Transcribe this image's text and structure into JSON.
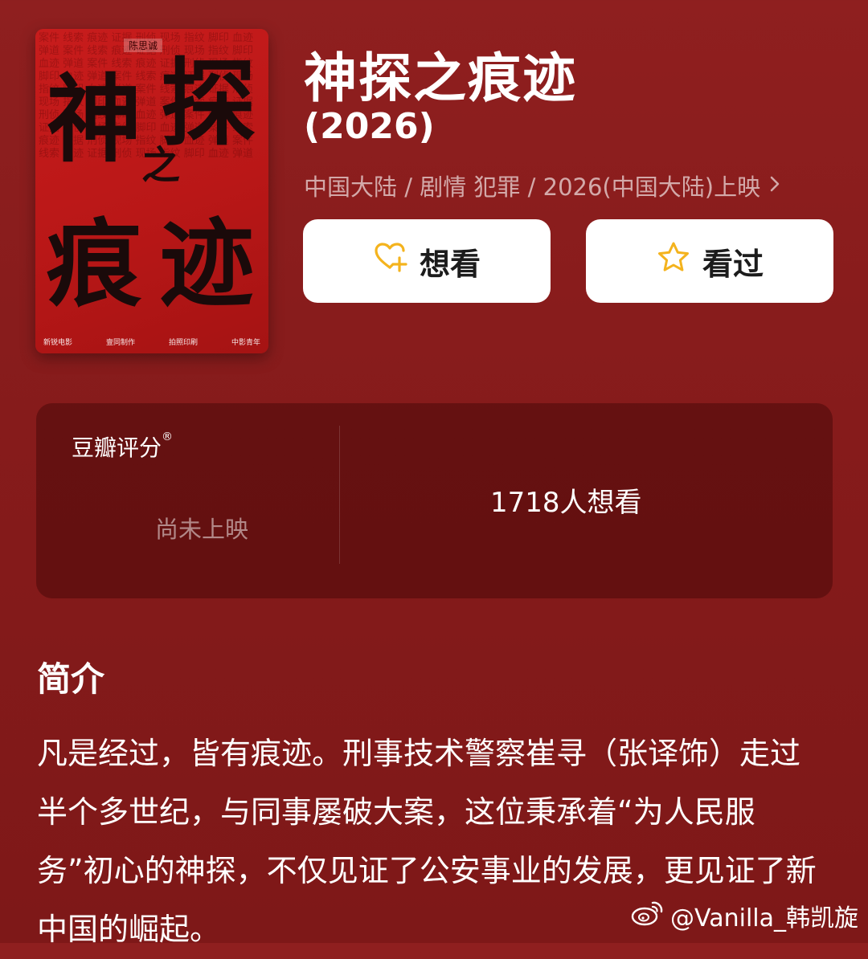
{
  "poster": {
    "director": "陈思诚",
    "title_chars": [
      "神",
      "探",
      "之",
      "痕",
      "迹"
    ],
    "logos": [
      "新锐电影",
      "壹同制作",
      "拍照印刷",
      "中影青年"
    ]
  },
  "movie": {
    "title": "神探之痕迹",
    "year": "(2026)",
    "meta": "中国大陆 / 剧情 犯罪 / 2026(中国大陆)上映"
  },
  "actions": {
    "want_label": "想看",
    "seen_label": "看过"
  },
  "rating": {
    "label": "豆瓣评分",
    "registered": "®",
    "status": "尚未上映",
    "want_count": "1718人想看"
  },
  "intro": {
    "heading": "简介",
    "body": "凡是经过，皆有痕迹。刑事技术警察崔寻（张译饰）走过半个多世纪，与同事屡破大案，这位秉承着“为人民服务”初心的神探，不仅见证了公安事业的发展，更见证了新中国的崛起。"
  },
  "watermark": {
    "text": "@Vanilla_韩凯旋"
  },
  "colors": {
    "background": "#8a1d1d",
    "poster_red": "#c01a1a",
    "accent_gold": "#f4b31d",
    "button_bg": "#ffffff"
  },
  "icons": {
    "want": "heart-plus-icon",
    "seen": "star-icon",
    "meta_more": "chevron-right-icon",
    "watermark": "weibo-icon"
  }
}
